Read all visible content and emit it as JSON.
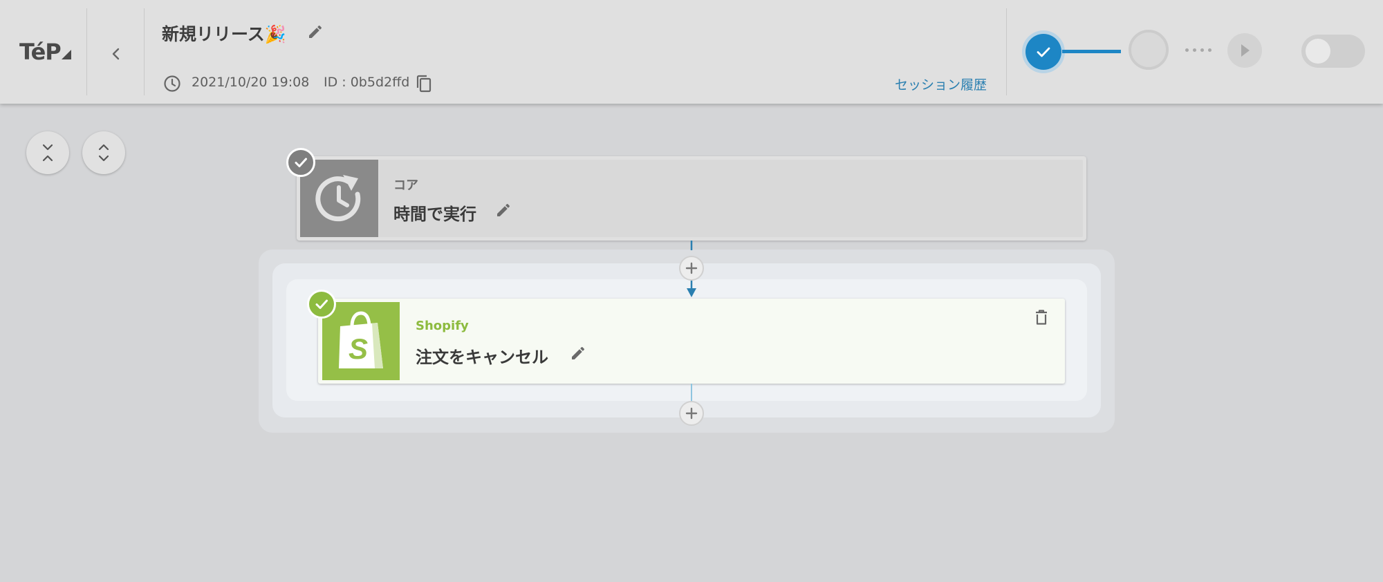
{
  "header": {
    "logo_text": "TéP",
    "flow_title": "新規リリース🎉",
    "timestamp": "2021/10/20 19:08",
    "flow_id": "ID : 0b5d2ffd",
    "session_history_label": "セッション履歴",
    "icons": [
      "chevron-left-icon",
      "pencil-icon",
      "clock-icon",
      "copy-icon",
      "check-icon",
      "play-icon"
    ]
  },
  "progress": {
    "steps": [
      "done",
      "pending"
    ],
    "toggle_on": false
  },
  "canvas_controls": {
    "icons": [
      "collapse-all-icon",
      "expand-all-icon"
    ]
  },
  "workflow": {
    "trigger": {
      "category": "コア",
      "name": "時間で実行",
      "icon": "clock-rotate-icon",
      "status": "complete"
    },
    "actions": [
      {
        "category": "Shopify",
        "name": "注文をキャンセル",
        "icon": "shopify-bag-icon",
        "status": "complete"
      }
    ]
  },
  "colors": {
    "accent": "#1d86c5",
    "shopify": "#95bf47",
    "link": "#2a7fb0",
    "check_gray": "#7f7f7f"
  }
}
